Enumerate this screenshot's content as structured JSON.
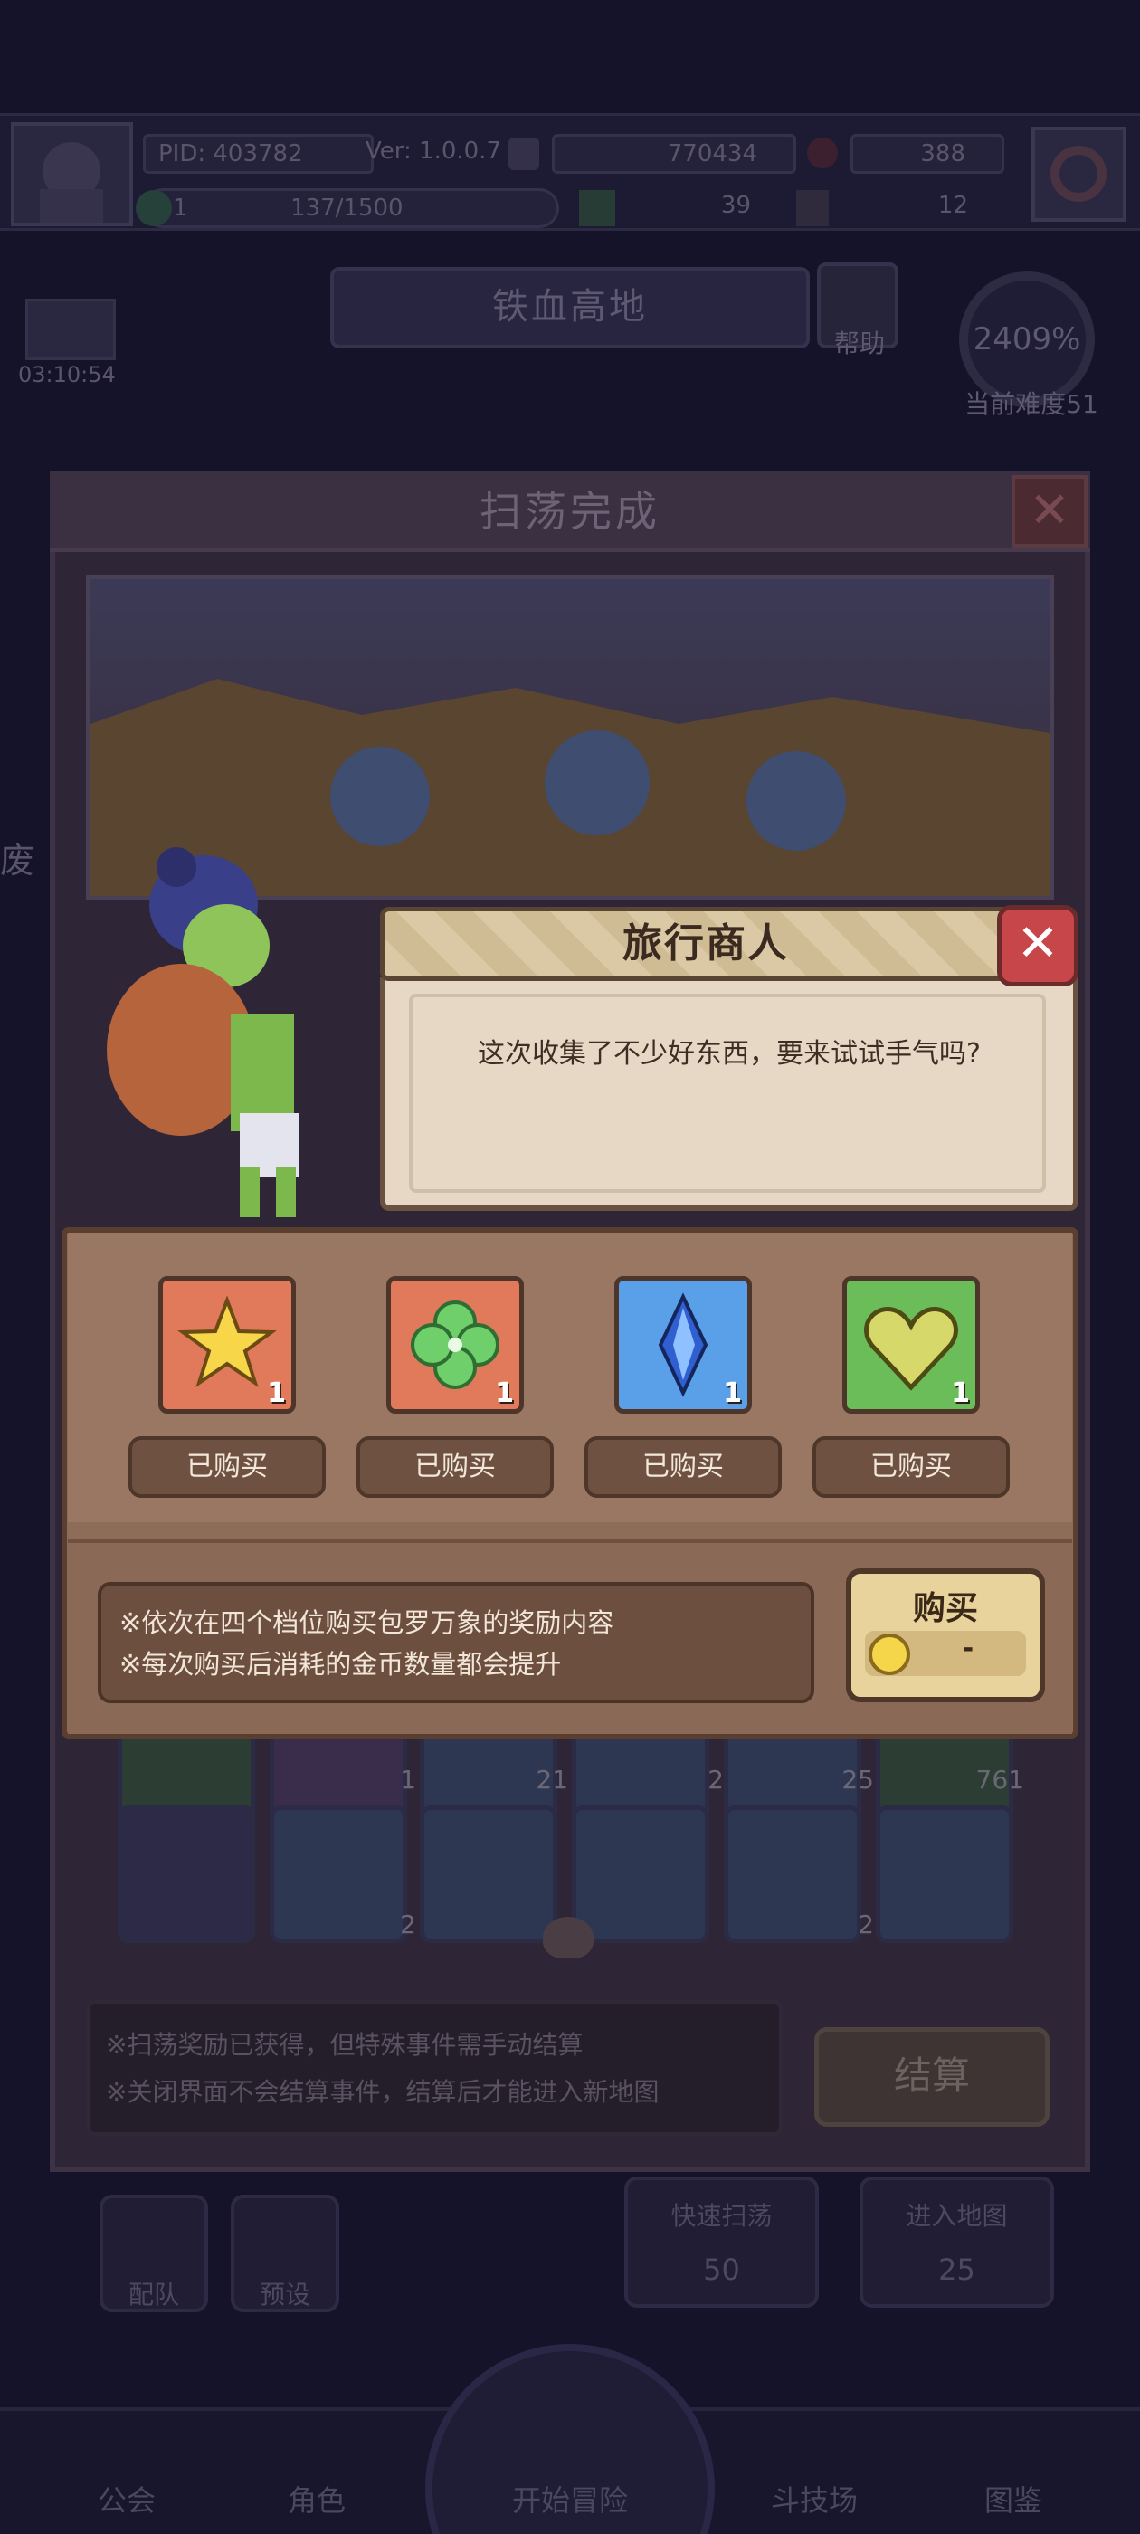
{
  "header": {
    "pid": "PID: 403782",
    "version": "Ver: 1.0.0.7",
    "gold": "770434",
    "gems": "388",
    "energy_value": "1",
    "exp": "137/1500",
    "clover": "39",
    "potion": "12"
  },
  "timer": "03:10:54",
  "map_name": "铁血高地",
  "help_label": "帮助",
  "difficulty": {
    "percent": "2409%",
    "label": "当前难度51"
  },
  "side_label": "废",
  "sweep": {
    "title": "扫荡完成",
    "inventory_counts": [
      "1",
      "21",
      "2",
      "25",
      "761",
      "2",
      "2"
    ],
    "notes": [
      "※扫荡奖励已获得，但特殊事件需手动结算",
      "※关闭界面不会结算事件，结算后才能进入新地图"
    ],
    "settle_label": "结算"
  },
  "actions": {
    "quick_sweep": {
      "label": "快速扫荡",
      "cost": "50"
    },
    "enter_map": {
      "label": "进入地图",
      "cost": "25"
    },
    "team": "配队",
    "preset": "预设"
  },
  "nav": [
    "公会",
    "角色",
    "开始冒险",
    "斗技场",
    "图鉴"
  ],
  "merchant": {
    "title": "旅行商人",
    "dialog": "这次收集了不少好东西，要来试试手气吗?",
    "slots": [
      {
        "icon": "star-icon",
        "qty": "1",
        "status": "已购买",
        "bg": "#e07a5a"
      },
      {
        "icon": "clover-icon",
        "qty": "1",
        "status": "已购买",
        "bg": "#e07a5a"
      },
      {
        "icon": "crystal-icon",
        "qty": "1",
        "status": "已购买",
        "bg": "#5aa0e8"
      },
      {
        "icon": "heart-icon",
        "qty": "1",
        "status": "已购买",
        "bg": "#6bbd5a"
      }
    ],
    "info": [
      "※依次在四个档位购买包罗万象的奖励内容",
      "※每次购买后消耗的金币数量都会提升"
    ],
    "buy_label": "购买",
    "buy_price": "-"
  },
  "colors": {
    "close": "#c7464a",
    "panel": "#8d6c58",
    "buy": "#e9d39c"
  }
}
